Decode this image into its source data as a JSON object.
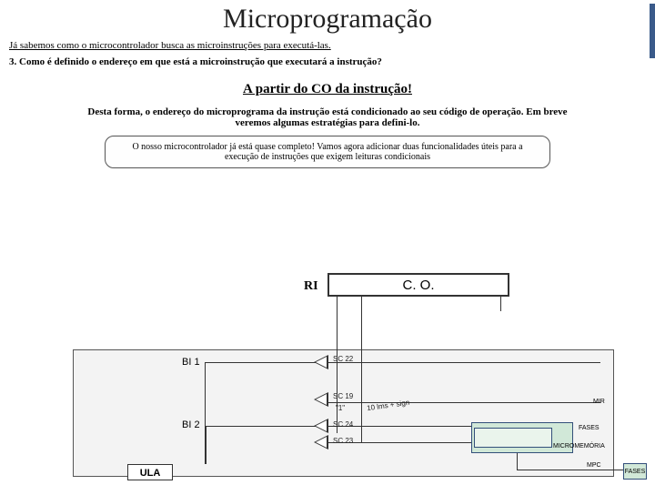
{
  "title": "Microprogramação",
  "intro": "Já sabemos como o microcontrolador busca as microinstruções para executá-las.",
  "question": "3. Como é definido o endereço em que está a microinstrução que executará a instrução?",
  "answer": "A partir do CO da instrução!",
  "para1": "Desta forma, o endereço do microprograma da instrução está condicionado ao seu código de operação. Em breve veremos algumas estratégias para defini-lo.",
  "callout": "O nosso microcontrolador já está quase completo! Vamos agora adicionar duas funcionalidades úteis para a execução de instruções que exigem leituras condicionais",
  "diagram": {
    "ri": "RI",
    "co": "C. O.",
    "bi1": "BI 1",
    "bi2": "BI 2",
    "ula": "ULA",
    "sc22": "SC 22",
    "sc19": "SC 19",
    "one": "\"1\"",
    "tenlms": "10 lms + sign",
    "sc24": "SC 24",
    "sc23": "SC 23",
    "mir": "MIR",
    "fases": "FASES",
    "micromem": "MICROMEMÓRIA",
    "mpc": "MPC"
  }
}
